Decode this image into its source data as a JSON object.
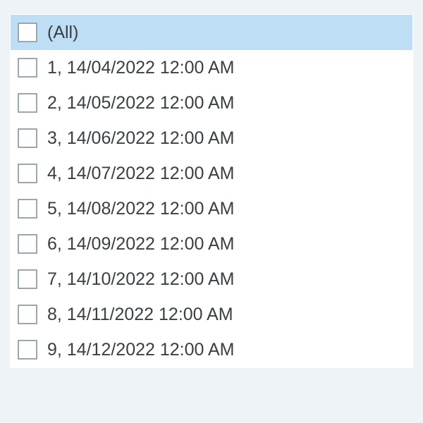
{
  "filter": {
    "allLabel": "(All)",
    "items": [
      {
        "label": "1, 14/04/2022 12:00 AM"
      },
      {
        "label": "2, 14/05/2022 12:00 AM"
      },
      {
        "label": "3, 14/06/2022 12:00 AM"
      },
      {
        "label": "4, 14/07/2022 12:00 AM"
      },
      {
        "label": "5, 14/08/2022 12:00 AM"
      },
      {
        "label": "6, 14/09/2022 12:00 AM"
      },
      {
        "label": "7, 14/10/2022 12:00 AM"
      },
      {
        "label": "8, 14/11/2022 12:00 AM"
      },
      {
        "label": "9, 14/12/2022 12:00 AM"
      }
    ]
  }
}
